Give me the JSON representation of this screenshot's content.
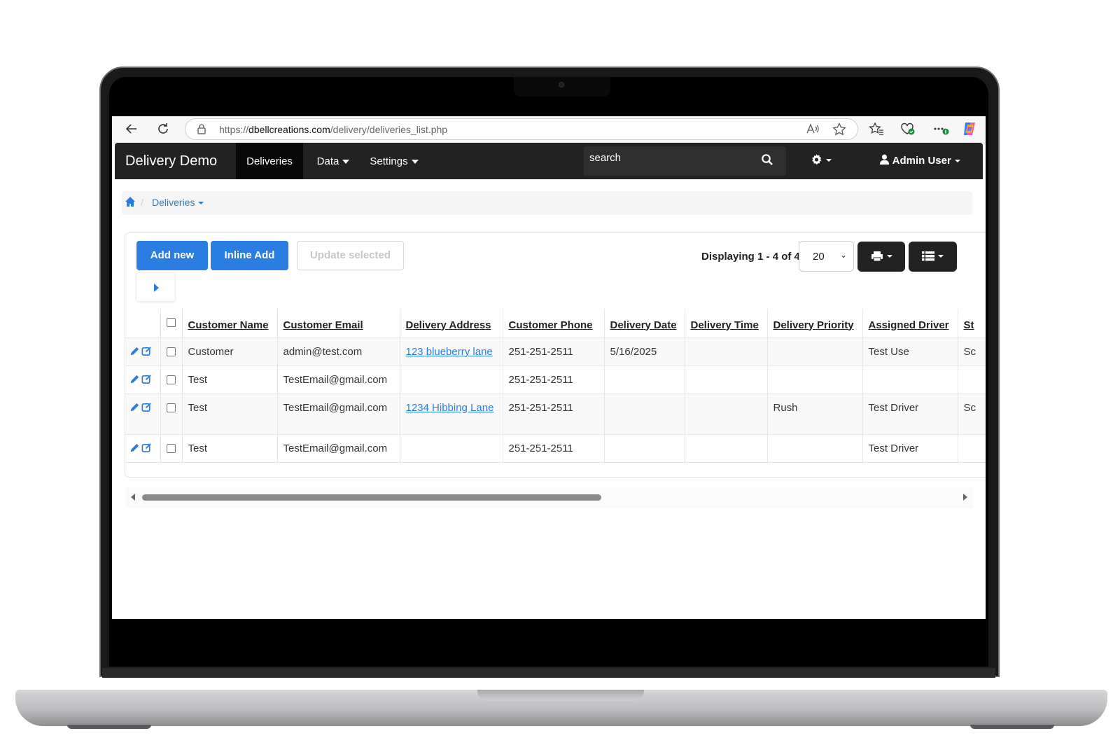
{
  "browser": {
    "url_scheme": "https://",
    "url_domain": "dbellcreations.com",
    "url_path": "/delivery/deliveries_list.php"
  },
  "navbar": {
    "brand": "Delivery Demo",
    "items": [
      {
        "label": "Deliveries",
        "active": true
      },
      {
        "label": "Data",
        "dropdown": true
      },
      {
        "label": "Settings",
        "dropdown": true
      }
    ],
    "search_placeholder": "search",
    "user": "Admin User"
  },
  "breadcrumb": {
    "current": "Deliveries"
  },
  "toolbar": {
    "add_new": "Add new",
    "inline_add": "Inline Add",
    "update_selected": "Update selected",
    "displaying": "Displaying 1 - 4 of 4",
    "per_page": "20"
  },
  "table": {
    "columns": [
      "Customer Name",
      "Customer Email",
      "Delivery Address",
      "Customer Phone",
      "Delivery Date",
      "Delivery Time",
      "Delivery Priority",
      "Assigned Driver",
      "St"
    ],
    "rows": [
      {
        "name": "Customer",
        "email": "admin@test.com",
        "address": "123 blueberry lane",
        "phone": "251-251-2511",
        "date": "5/16/2025",
        "time": "",
        "priority": "",
        "driver": "Test Use",
        "status": "Sc"
      },
      {
        "name": "Test",
        "email": "TestEmail@gmail.com",
        "address": "",
        "phone": "251-251-2511",
        "date": "",
        "time": "",
        "priority": "",
        "driver": "",
        "status": ""
      },
      {
        "name": "Test",
        "email": "TestEmail@gmail.com",
        "address": "1234 Hibbing Lane",
        "phone": "251-251-2511",
        "date": "",
        "time": "",
        "priority": "Rush",
        "driver": "Test Driver",
        "status": "Sc"
      },
      {
        "name": "Test",
        "email": "TestEmail@gmail.com",
        "address": "",
        "phone": "251-251-2511",
        "date": "",
        "time": "",
        "priority": "",
        "driver": "Test Driver",
        "status": ""
      }
    ]
  },
  "colors": {
    "navbar": "#222222",
    "primary": "#2a7de1",
    "link": "#337ab7"
  },
  "icons": [
    "back-arrow-icon",
    "refresh-icon",
    "lock-icon",
    "read-aloud-icon",
    "star-icon",
    "favorites-icon",
    "browser-essentials-icon",
    "more-icon",
    "copilot-icon",
    "search-icon",
    "gear-icon",
    "user-icon",
    "home-icon",
    "print-icon",
    "list-icon",
    "pencil-icon",
    "edit-square-icon"
  ]
}
